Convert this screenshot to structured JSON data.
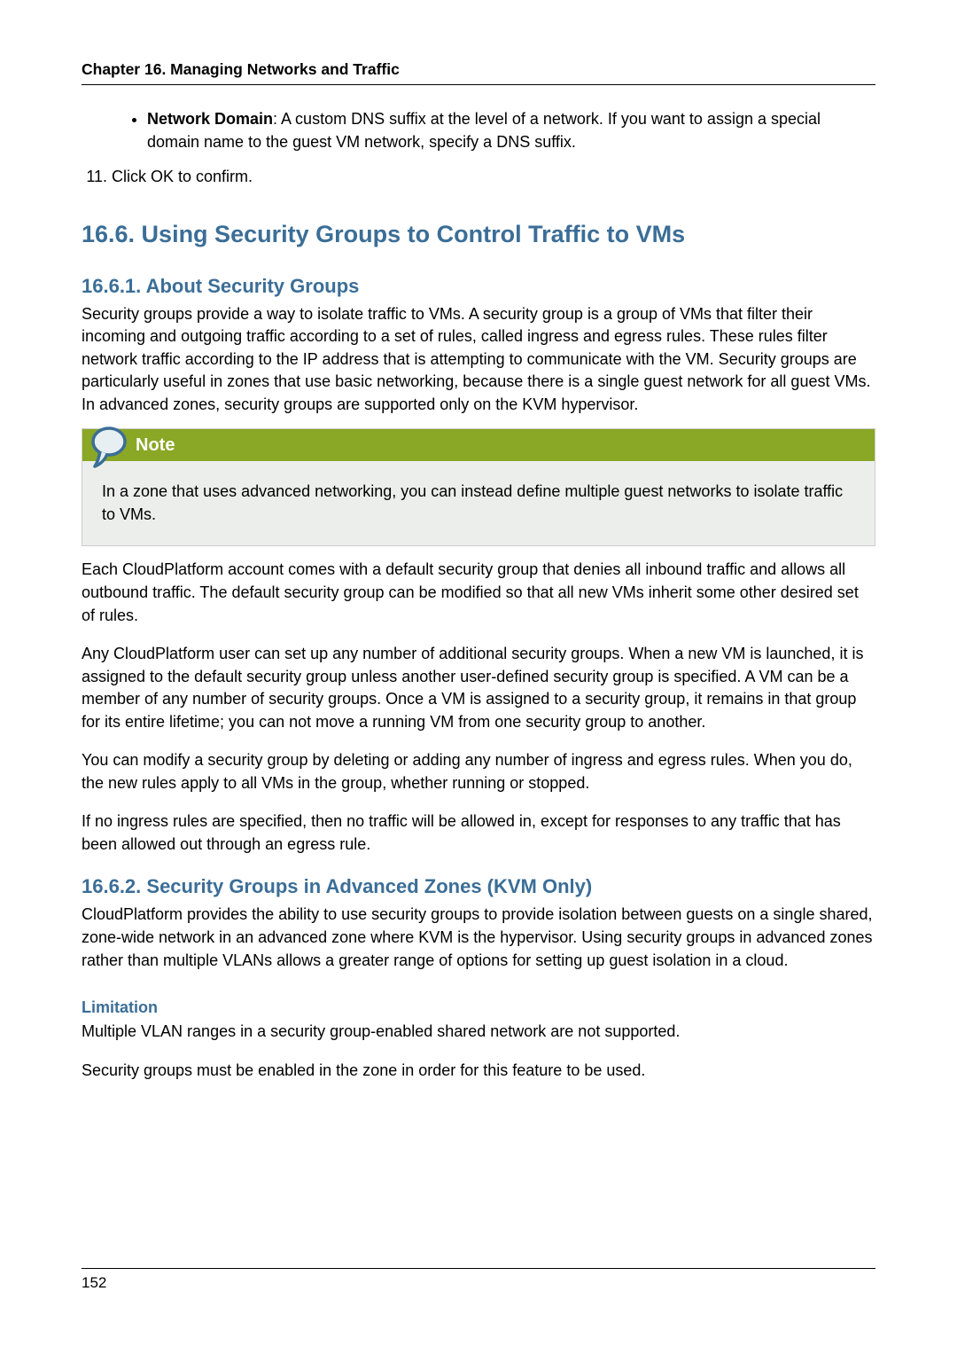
{
  "header": {
    "chapter_line": "Chapter 16. Managing Networks and Traffic"
  },
  "bullet": {
    "label": "Network Domain",
    "text": ": A custom DNS suffix at the level of a network. If you want to assign a special domain name to the guest VM network, specify a DNS suffix."
  },
  "step11": "Click OK to confirm.",
  "sec16_6": {
    "title": "16.6. Using Security Groups to Control Traffic to VMs"
  },
  "sec16_6_1": {
    "title": "16.6.1. About Security Groups",
    "p1": "Security groups provide a way to isolate traffic to VMs. A security group is a group of VMs that filter their incoming and outgoing traffic according to a set of rules, called ingress and egress rules. These rules filter network traffic according to the IP address that is attempting to communicate with the VM. Security groups are particularly useful in zones that use basic networking, because there is a single guest network for all guest VMs. In advanced zones, security groups are supported only on the KVM hypervisor.",
    "note_title": "Note",
    "note_body": "In a zone that uses advanced networking, you can instead define multiple guest networks to isolate traffic to VMs.",
    "p2": "Each CloudPlatform account comes with a default security group that denies all inbound traffic and allows all outbound traffic. The default security group can be modified so that all new VMs inherit some other desired set of rules.",
    "p3": "Any CloudPlatform user can set up any number of additional security groups. When a new VM is launched, it is assigned to the default security group unless another user-defined security group is specified. A VM can be a member of any number of security groups. Once a VM is assigned to a security group, it remains in that group for its entire lifetime; you can not move a running VM from one security group to another.",
    "p4": "You can modify a security group by deleting or adding any number of ingress and egress rules. When you do, the new rules apply to all VMs in the group, whether running or stopped.",
    "p5": "If no ingress rules are specified, then no traffic will be allowed in, except for responses to any traffic that has been allowed out through an egress rule."
  },
  "sec16_6_2": {
    "title": "16.6.2. Security Groups in Advanced Zones (KVM Only)",
    "p1": "CloudPlatform provides the ability to use security groups to provide isolation between guests on a single shared, zone-wide network in an advanced zone where KVM is the hypervisor. Using security groups in advanced zones rather than multiple VLANs allows a greater range of options for setting up guest isolation in a cloud.",
    "limitation_title": "Limitation",
    "lp1": "Multiple VLAN ranges in a security group-enabled shared network are not supported.",
    "lp2": "Security groups must be enabled in the zone in order for this feature to be used."
  },
  "footer": {
    "page_number": "152"
  }
}
